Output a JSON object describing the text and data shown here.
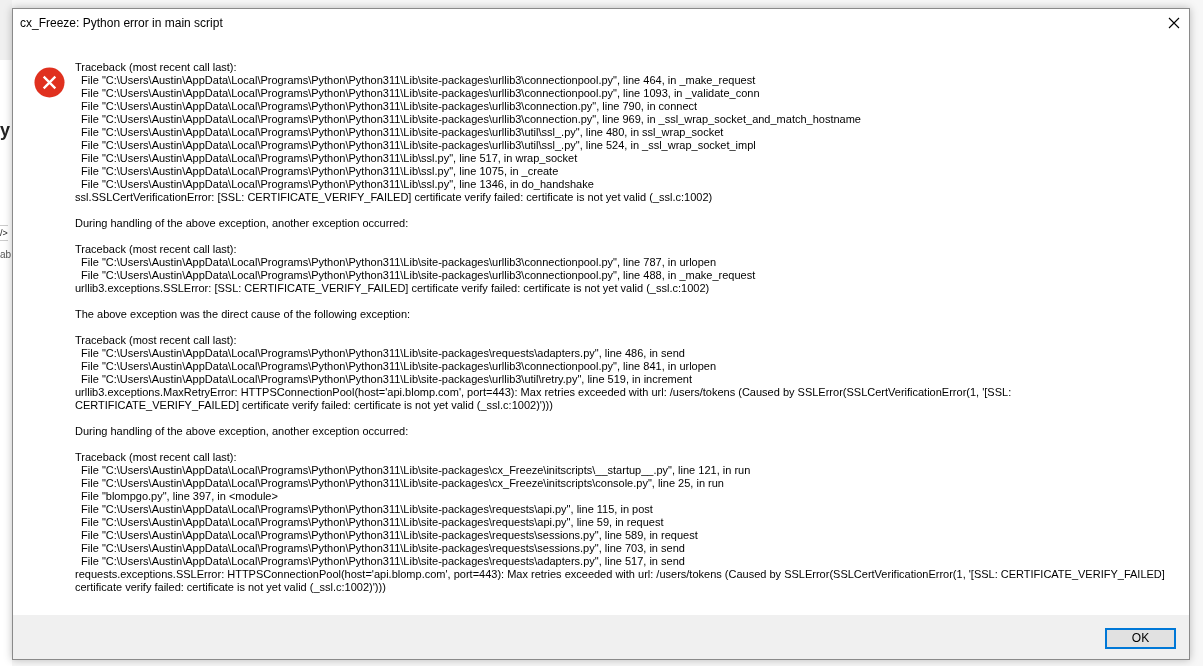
{
  "background_window": {
    "fragments": [
      "y",
      "/>",
      "ab"
    ]
  },
  "dialog": {
    "title": "cx_Freeze: Python error in main script",
    "message_blocks": [
      [
        "Traceback (most recent call last):",
        "  File \"C:\\Users\\Austin\\AppData\\Local\\Programs\\Python\\Python311\\Lib\\site-packages\\urllib3\\connectionpool.py\", line 464, in _make_request",
        "  File \"C:\\Users\\Austin\\AppData\\Local\\Programs\\Python\\Python311\\Lib\\site-packages\\urllib3\\connectionpool.py\", line 1093, in _validate_conn",
        "  File \"C:\\Users\\Austin\\AppData\\Local\\Programs\\Python\\Python311\\Lib\\site-packages\\urllib3\\connection.py\", line 790, in connect",
        "  File \"C:\\Users\\Austin\\AppData\\Local\\Programs\\Python\\Python311\\Lib\\site-packages\\urllib3\\connection.py\", line 969, in _ssl_wrap_socket_and_match_hostname",
        "  File \"C:\\Users\\Austin\\AppData\\Local\\Programs\\Python\\Python311\\Lib\\site-packages\\urllib3\\util\\ssl_.py\", line 480, in ssl_wrap_socket",
        "  File \"C:\\Users\\Austin\\AppData\\Local\\Programs\\Python\\Python311\\Lib\\site-packages\\urllib3\\util\\ssl_.py\", line 524, in _ssl_wrap_socket_impl",
        "  File \"C:\\Users\\Austin\\AppData\\Local\\Programs\\Python\\Python311\\Lib\\ssl.py\", line 517, in wrap_socket",
        "  File \"C:\\Users\\Austin\\AppData\\Local\\Programs\\Python\\Python311\\Lib\\ssl.py\", line 1075, in _create",
        "  File \"C:\\Users\\Austin\\AppData\\Local\\Programs\\Python\\Python311\\Lib\\ssl.py\", line 1346, in do_handshake",
        "ssl.SSLCertVerificationError: [SSL: CERTIFICATE_VERIFY_FAILED] certificate verify failed: certificate is not yet valid (_ssl.c:1002)"
      ],
      [
        "During handling of the above exception, another exception occurred:"
      ],
      [
        "Traceback (most recent call last):",
        "  File \"C:\\Users\\Austin\\AppData\\Local\\Programs\\Python\\Python311\\Lib\\site-packages\\urllib3\\connectionpool.py\", line 787, in urlopen",
        "  File \"C:\\Users\\Austin\\AppData\\Local\\Programs\\Python\\Python311\\Lib\\site-packages\\urllib3\\connectionpool.py\", line 488, in _make_request",
        "urllib3.exceptions.SSLError: [SSL: CERTIFICATE_VERIFY_FAILED] certificate verify failed: certificate is not yet valid (_ssl.c:1002)"
      ],
      [
        "The above exception was the direct cause of the following exception:"
      ],
      [
        "Traceback (most recent call last):",
        "  File \"C:\\Users\\Austin\\AppData\\Local\\Programs\\Python\\Python311\\Lib\\site-packages\\requests\\adapters.py\", line 486, in send",
        "  File \"C:\\Users\\Austin\\AppData\\Local\\Programs\\Python\\Python311\\Lib\\site-packages\\urllib3\\connectionpool.py\", line 841, in urlopen",
        "  File \"C:\\Users\\Austin\\AppData\\Local\\Programs\\Python\\Python311\\Lib\\site-packages\\urllib3\\util\\retry.py\", line 519, in increment",
        "urllib3.exceptions.MaxRetryError: HTTPSConnectionPool(host='api.blomp.com', port=443): Max retries exceeded with url: /users/tokens (Caused by SSLError(SSLCertVerificationError(1, '[SSL:",
        "CERTIFICATE_VERIFY_FAILED] certificate verify failed: certificate is not yet valid (_ssl.c:1002)')))"
      ],
      [
        "During handling of the above exception, another exception occurred:"
      ],
      [
        "Traceback (most recent call last):",
        "  File \"C:\\Users\\Austin\\AppData\\Local\\Programs\\Python\\Python311\\Lib\\site-packages\\cx_Freeze\\initscripts\\__startup__.py\", line 121, in run",
        "  File \"C:\\Users\\Austin\\AppData\\Local\\Programs\\Python\\Python311\\Lib\\site-packages\\cx_Freeze\\initscripts\\console.py\", line 25, in run",
        "  File \"blompgo.py\", line 397, in <module>",
        "  File \"C:\\Users\\Austin\\AppData\\Local\\Programs\\Python\\Python311\\Lib\\site-packages\\requests\\api.py\", line 115, in post",
        "  File \"C:\\Users\\Austin\\AppData\\Local\\Programs\\Python\\Python311\\Lib\\site-packages\\requests\\api.py\", line 59, in request",
        "  File \"C:\\Users\\Austin\\AppData\\Local\\Programs\\Python\\Python311\\Lib\\site-packages\\requests\\sessions.py\", line 589, in request",
        "  File \"C:\\Users\\Austin\\AppData\\Local\\Programs\\Python\\Python311\\Lib\\site-packages\\requests\\sessions.py\", line 703, in send",
        "  File \"C:\\Users\\Austin\\AppData\\Local\\Programs\\Python\\Python311\\Lib\\site-packages\\requests\\adapters.py\", line 517, in send",
        "requests.exceptions.SSLError: HTTPSConnectionPool(host='api.blomp.com', port=443): Max retries exceeded with url: /users/tokens (Caused by SSLError(SSLCertVerificationError(1, '[SSL: CERTIFICATE_VERIFY_FAILED]",
        "certificate verify failed: certificate is not yet valid (_ssl.c:1002)')))"
      ]
    ],
    "buttons": [
      "OK"
    ]
  }
}
